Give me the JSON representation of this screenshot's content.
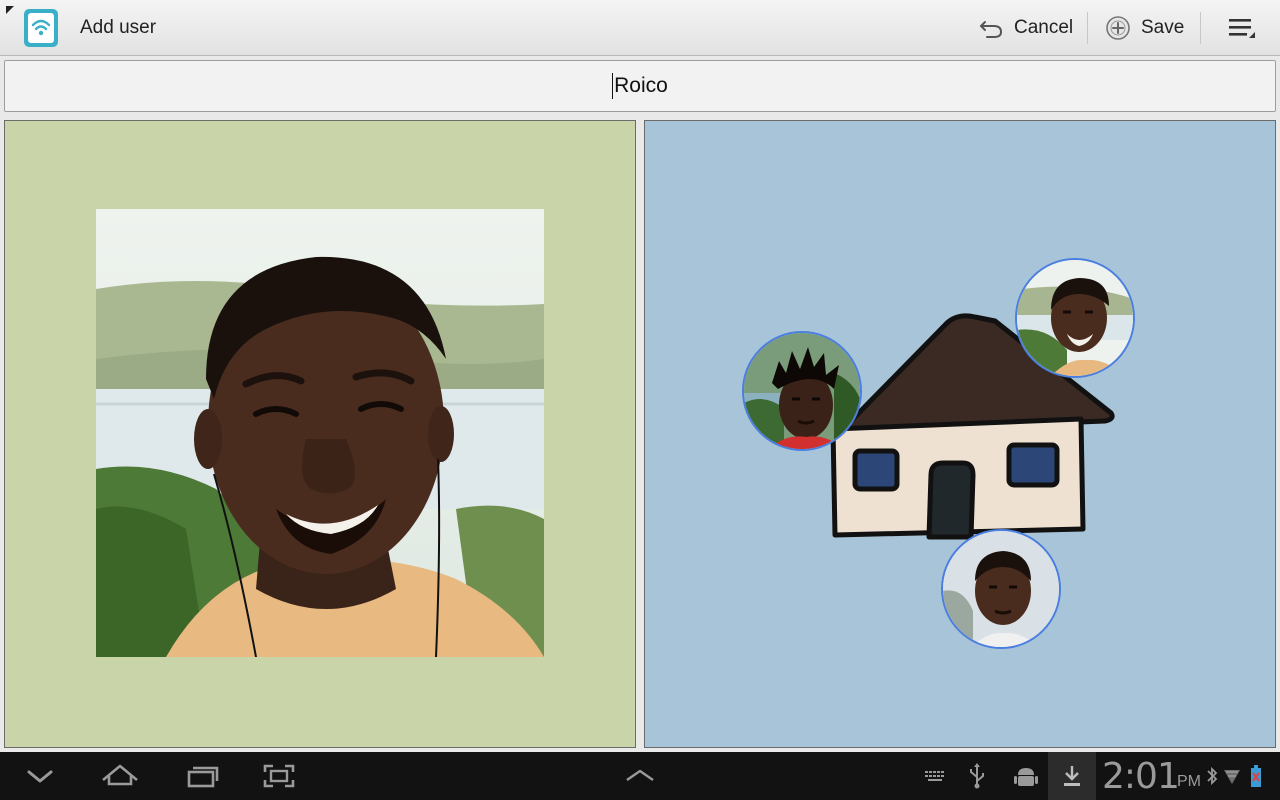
{
  "actionbar": {
    "title": "Add user",
    "cancel_label": "Cancel",
    "save_label": "Save"
  },
  "name_field": {
    "value": "Roico"
  },
  "status_bar": {
    "time": "2:01",
    "ampm": "PM"
  },
  "colors": {
    "left_panel_bg": "#c9d4a8",
    "right_panel_bg": "#a8c4d8",
    "thumb_border": "#4a7ee0",
    "app_icon_accent": "#3ab0c8"
  },
  "icons": {
    "app": "wifi-tablet-icon",
    "cancel": "undo-arrow-icon",
    "save": "plus-circle-icon",
    "overflow": "overflow-menu-icon",
    "nav": [
      "back-icon",
      "home-icon",
      "recent-apps-icon",
      "screenshot-icon",
      "up-caret-icon"
    ],
    "status": [
      "keyboard-icon",
      "usb-icon",
      "android-debug-icon",
      "download-icon",
      "bluetooth-icon",
      "signal-icon",
      "battery-icon"
    ]
  }
}
